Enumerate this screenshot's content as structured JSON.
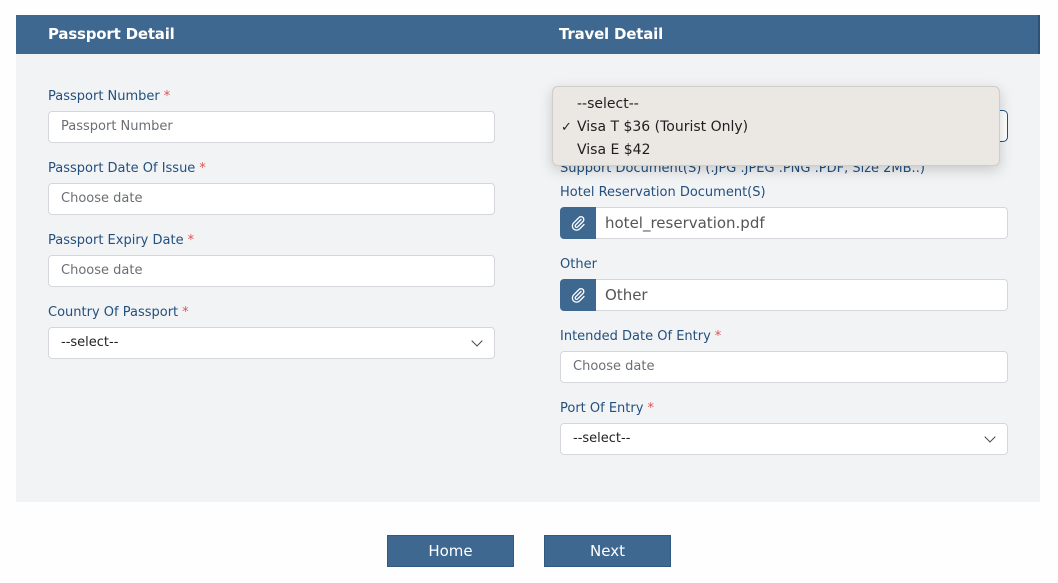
{
  "sections": {
    "passport_title": "Passport Detail",
    "travel_title": "Travel Detail"
  },
  "passport": {
    "number": {
      "label": "Passport Number",
      "required": "*",
      "placeholder": "Passport Number"
    },
    "issue_date": {
      "label": "Passport Date Of Issue",
      "required": "*",
      "placeholder": "Choose date"
    },
    "expiry_date": {
      "label": "Passport Expiry Date",
      "required": "*",
      "placeholder": "Choose date"
    },
    "country": {
      "label": "Country Of Passport",
      "required": "*",
      "value": "--select--"
    }
  },
  "travel": {
    "visa_dropdown": {
      "options": [
        {
          "label": "--select--",
          "selected": false
        },
        {
          "label": "Visa T $36 (Tourist Only)",
          "selected": true
        },
        {
          "label": "Visa E $42",
          "selected": false
        }
      ],
      "check_mark": "✓"
    },
    "support_note": "Support Document(S) (.JPG .JPEG .PNG .PDF, Size 2MB..)",
    "hotel_doc": {
      "label": "Hotel Reservation Document(S)",
      "value": "hotel_reservation.pdf"
    },
    "other_doc": {
      "label": "Other",
      "value": "Other"
    },
    "entry_date": {
      "label": "Intended Date Of Entry",
      "required": "*",
      "placeholder": "Choose date"
    },
    "port": {
      "label": "Port Of Entry",
      "required": "*",
      "value": "--select--"
    }
  },
  "buttons": {
    "home": "Home",
    "next": "Next"
  },
  "colors": {
    "brand": "#3f6890",
    "label": "#24507e",
    "required": "#e05252"
  }
}
